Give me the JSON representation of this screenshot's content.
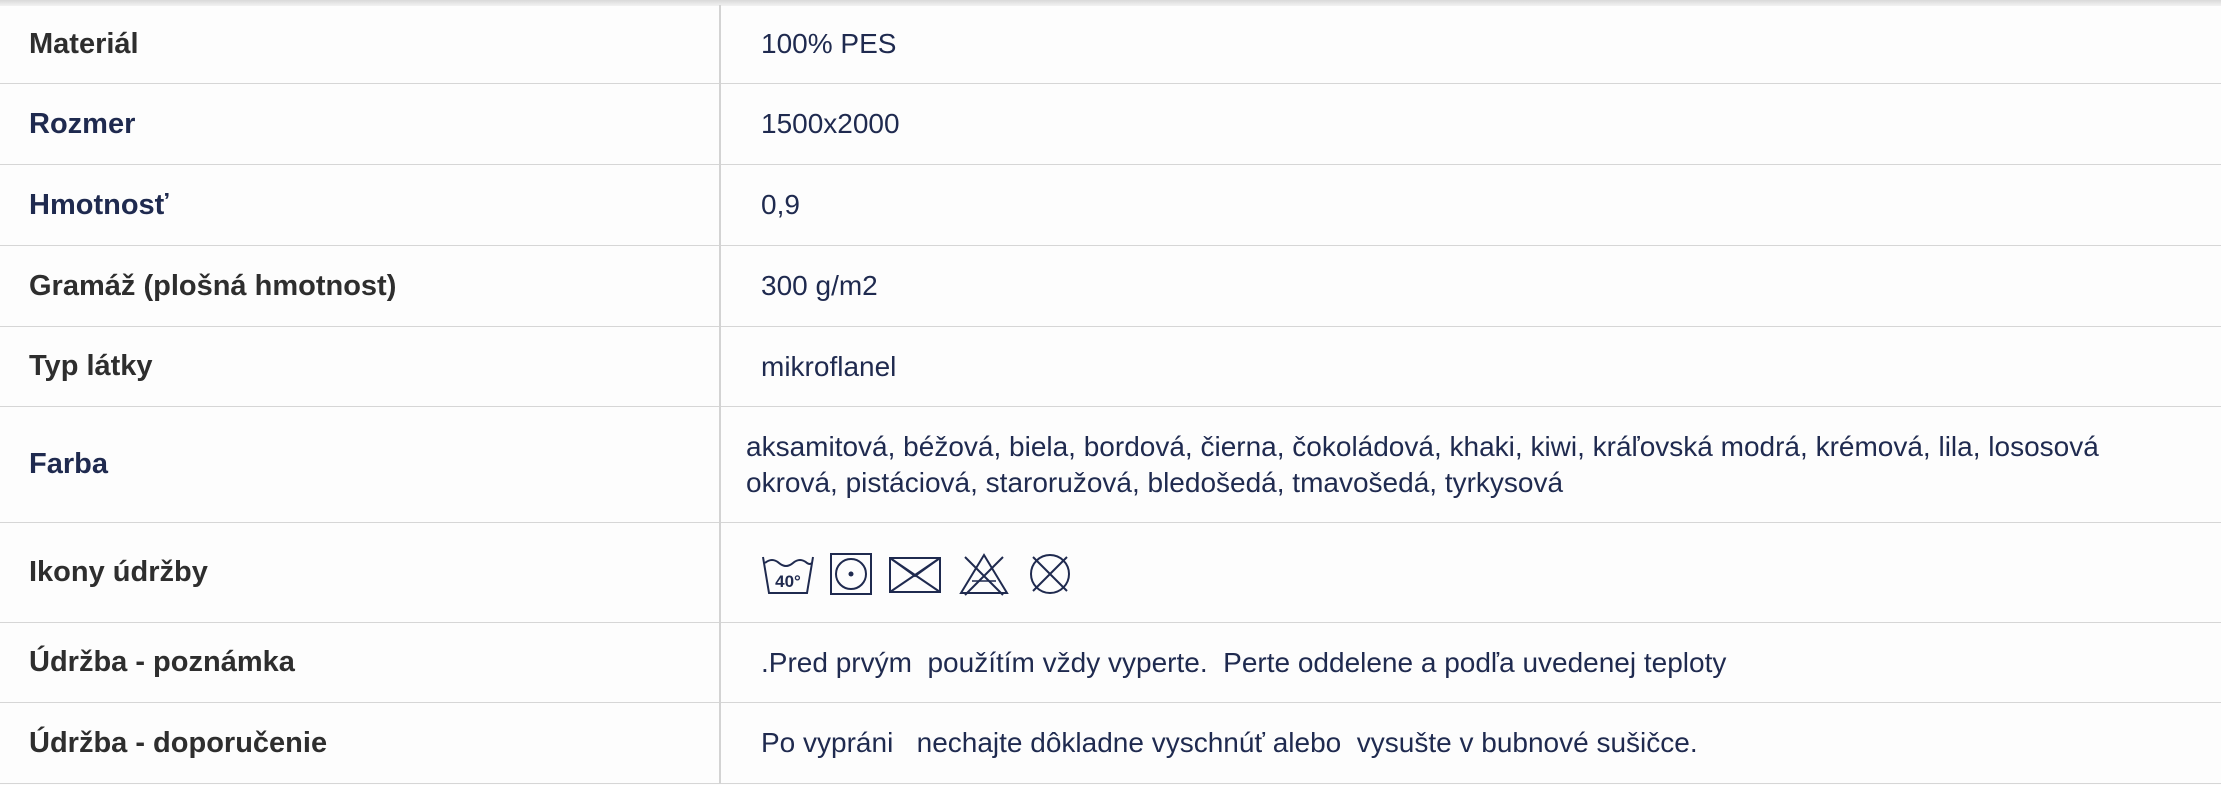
{
  "rows": [
    {
      "label": "Materiál",
      "value": "100% PES"
    },
    {
      "label": "Rozmer",
      "value": "1500x2000"
    },
    {
      "label": "Hmotnosť",
      "value": "0,9"
    },
    {
      "label": "Gramáž (plošná hmotnost)",
      "value": "300 g/m2"
    },
    {
      "label": "Typ látky",
      "value": "mikroflanel"
    },
    {
      "label": "Farba",
      "value": "aksamitová, béžová, biela, bordová, čierna, čokoládová, khaki, kiwi, kráľovská modrá, krémová, lila, lososová okrová, pistáciová, staroružová, bledošedá, tmavošedá, tyrkysová"
    },
    {
      "label": "Ikony údržby",
      "icons": [
        "wash-40-icon",
        "tumble-dry-icon",
        "iron-crossed-icon",
        "bleach-crossed-icon",
        "dry-clean-crossed-icon"
      ],
      "wash_temp": "40°"
    },
    {
      "label": "Údržba - poznámka",
      "value": ".Pred prvým  použítím vždy vyperte.  Perte oddelene a podľa uvedenej teploty"
    },
    {
      "label": "Údržba - doporučenie",
      "value": "Po vypráni   nechajte dôkladne vyschnúť alebo  vysušte v bubnové sušičce."
    }
  ],
  "colors": {
    "label_dark": "#2e2e2e",
    "label_navy": "#1f2a4f",
    "value_text": "#1f2a4f",
    "border": "#d6d6d6"
  }
}
